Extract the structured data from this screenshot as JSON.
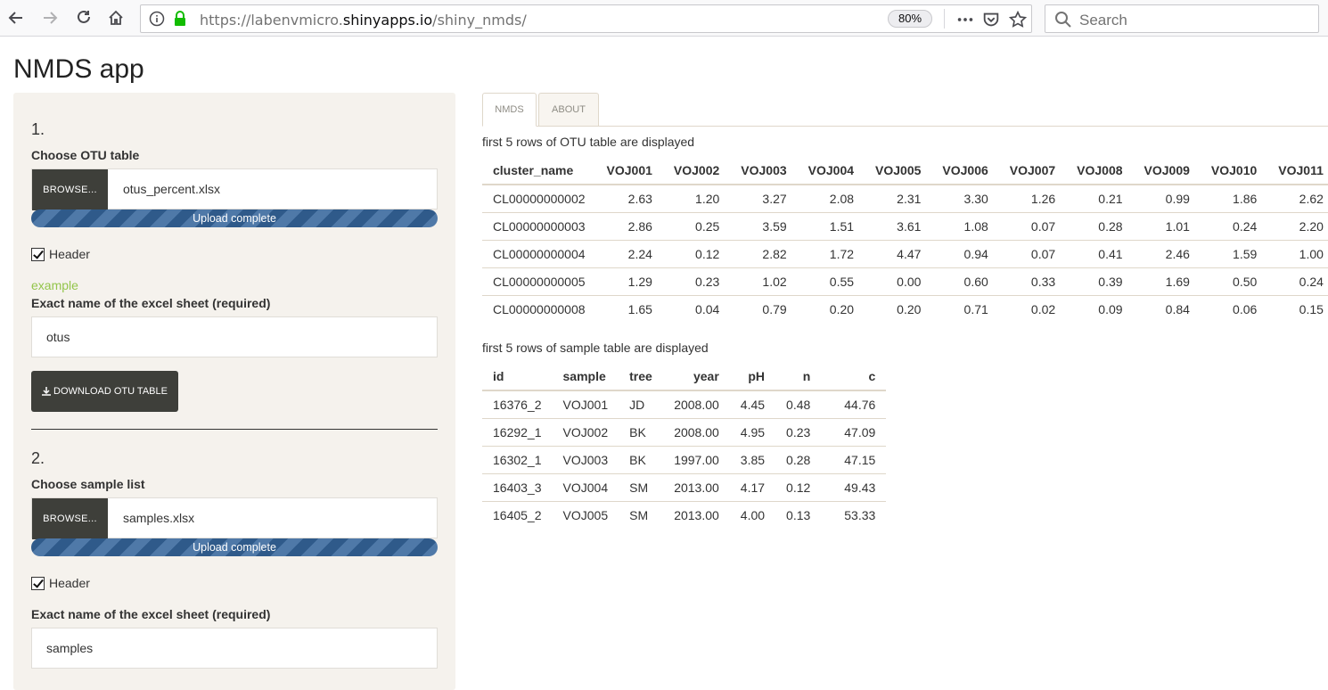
{
  "browser": {
    "url_scheme": "https://labenvmicro.",
    "url_host": "shinyapps.io",
    "url_path": "/shiny_nmds/",
    "zoom": "80%",
    "search_placeholder": "Search"
  },
  "app": {
    "title": "NMDS app"
  },
  "sidebar": {
    "step1": {
      "number": "1.",
      "choose_label": "Choose OTU table",
      "browse_label": "BROWSE...",
      "file_name": "otus_percent.xlsx",
      "progress_text": "Upload complete",
      "header_label": "Header",
      "header_checked": true,
      "example_link": "example",
      "sheet_label": "Exact name of the excel sheet (required)",
      "sheet_value": "otus",
      "download_label": "DOWNLOAD OTU TABLE"
    },
    "step2": {
      "number": "2.",
      "choose_label": "Choose sample list",
      "browse_label": "BROWSE...",
      "file_name": "samples.xlsx",
      "progress_text": "Upload complete",
      "header_label": "Header",
      "header_checked": true,
      "sheet_label": "Exact name of the excel sheet (required)",
      "sheet_value": "samples"
    }
  },
  "tabs": [
    {
      "label": "NMDS",
      "active": true
    },
    {
      "label": "ABOUT",
      "active": false
    }
  ],
  "otu_table": {
    "caption": "first 5 rows of OTU table are displayed",
    "columns": [
      "cluster_name",
      "VOJ001",
      "VOJ002",
      "VOJ003",
      "VOJ004",
      "VOJ005",
      "VOJ006",
      "VOJ007",
      "VOJ008",
      "VOJ009",
      "VOJ010",
      "VOJ011"
    ],
    "rows": [
      [
        "CL00000000002",
        "2.63",
        "1.20",
        "3.27",
        "2.08",
        "2.31",
        "3.30",
        "1.26",
        "0.21",
        "0.99",
        "1.86",
        "2.62"
      ],
      [
        "CL00000000003",
        "2.86",
        "0.25",
        "3.59",
        "1.51",
        "3.61",
        "1.08",
        "0.07",
        "0.28",
        "1.01",
        "0.24",
        "2.20"
      ],
      [
        "CL00000000004",
        "2.24",
        "0.12",
        "2.82",
        "1.72",
        "4.47",
        "0.94",
        "0.07",
        "0.41",
        "2.46",
        "1.59",
        "1.00"
      ],
      [
        "CL00000000005",
        "1.29",
        "0.23",
        "1.02",
        "0.55",
        "0.00",
        "0.60",
        "0.33",
        "0.39",
        "1.69",
        "0.50",
        "0.24"
      ],
      [
        "CL00000000008",
        "1.65",
        "0.04",
        "0.79",
        "0.20",
        "0.20",
        "0.71",
        "0.02",
        "0.09",
        "0.84",
        "0.06",
        "0.15"
      ]
    ]
  },
  "sample_table": {
    "caption": "first 5 rows of sample table are displayed",
    "columns": [
      "id",
      "sample",
      "tree",
      "year",
      "pH",
      "n",
      "c"
    ],
    "rows": [
      [
        "16376_2",
        "VOJ001",
        "JD",
        "2008.00",
        "4.45",
        "0.48",
        "44.76"
      ],
      [
        "16292_1",
        "VOJ002",
        "BK",
        "2008.00",
        "4.95",
        "0.23",
        "47.09"
      ],
      [
        "16302_1",
        "VOJ003",
        "BK",
        "1997.00",
        "3.85",
        "0.28",
        "47.15"
      ],
      [
        "16403_3",
        "VOJ004",
        "SM",
        "2013.00",
        "4.17",
        "0.12",
        "49.43"
      ],
      [
        "16405_2",
        "VOJ005",
        "SM",
        "2013.00",
        "4.00",
        "0.13",
        "53.33"
      ]
    ]
  },
  "icons": {
    "back": "arrow-left-icon",
    "forward": "arrow-right-icon",
    "reload": "reload-icon",
    "home": "home-icon",
    "info": "info-icon",
    "lock": "lock-icon",
    "more": "more-icon",
    "pocket": "pocket-icon",
    "bookmark": "star-icon",
    "search": "search-icon",
    "download": "download-icon"
  },
  "colors": {
    "accent_green": "#93c54b",
    "dark_button": "#3e3f3a",
    "sidebar_bg": "#f5f2ed",
    "progress_blue": "#2f5a8a",
    "lock_green": "#12bc00"
  }
}
